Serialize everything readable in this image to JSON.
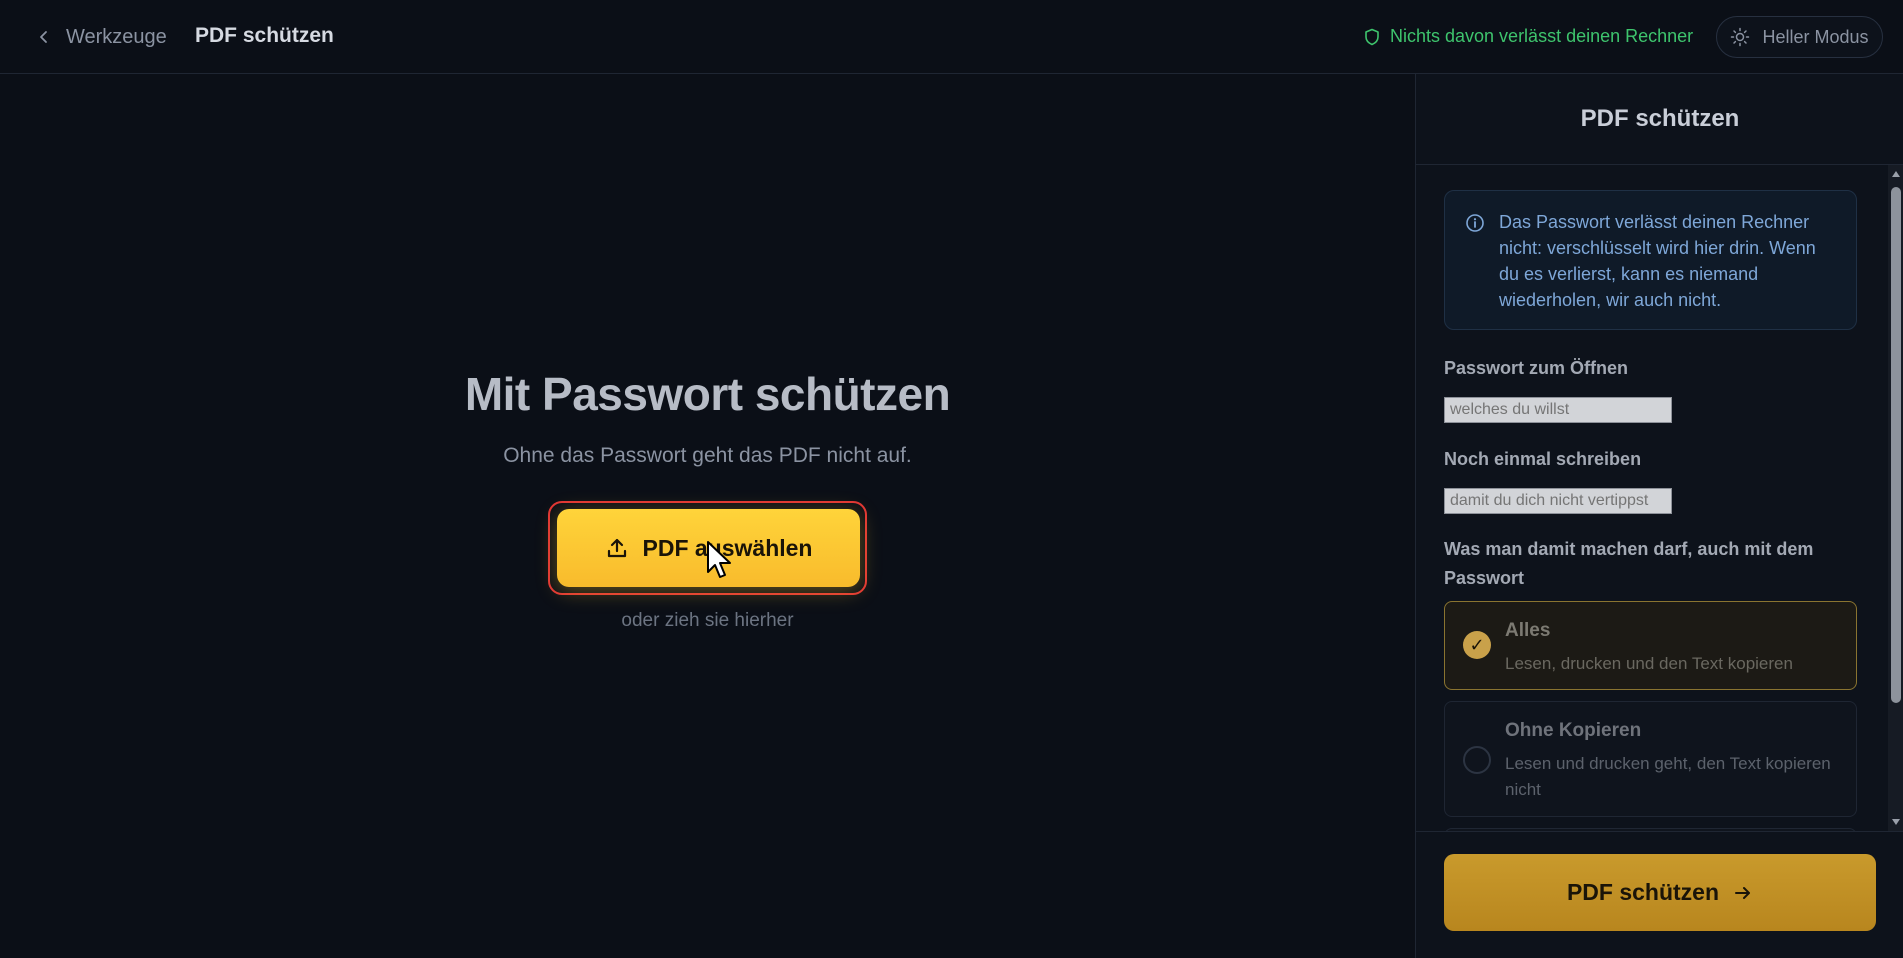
{
  "header": {
    "back_label": "Werkzeuge",
    "title": "PDF schützen",
    "privacy_text": "Nichts davon verlässt deinen Rechner",
    "mode_label": "Heller Modus"
  },
  "main": {
    "title": "Mit Passwort schützen",
    "subtitle": "Ohne das Passwort geht das PDF nicht auf.",
    "upload_label": "PDF auswählen",
    "drop_hint": "oder zieh sie hierher"
  },
  "sidebar": {
    "title": "PDF schützen",
    "info": "Das Passwort verlässt deinen Rechner nicht: verschlüsselt wird hier drin. Wenn du es verlierst, kann es niemand wiederholen, wir auch nicht.",
    "password_label": "Passwort zum Öffnen",
    "password_placeholder": "welches du willst",
    "confirm_label": "Noch einmal schreiben",
    "confirm_placeholder": "damit du dich nicht vertippst",
    "permissions_label": "Was man damit machen darf, auch mit dem Passwort",
    "options": [
      {
        "title": "Alles",
        "desc": "Lesen, drucken und den Text kopieren",
        "selected": true
      },
      {
        "title": "Ohne Kopieren",
        "desc": "Lesen und drucken geht, den Text kopieren nicht",
        "selected": false
      }
    ],
    "submit_label": "PDF schützen"
  },
  "colors": {
    "accent": "#f8bb2c",
    "privacy_green": "#3ec46d",
    "info_blue": "#7ea7d8"
  }
}
